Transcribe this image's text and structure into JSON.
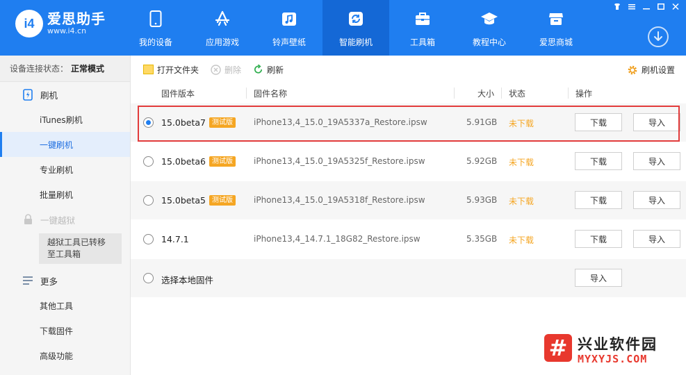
{
  "app": {
    "logo_badge": "i4",
    "name": "爱思助手",
    "url": "www.i4.cn"
  },
  "nav": [
    {
      "label": "我的设备",
      "icon": "phone-icon"
    },
    {
      "label": "应用游戏",
      "icon": "app-store-icon"
    },
    {
      "label": "铃声壁纸",
      "icon": "music-icon"
    },
    {
      "label": "智能刷机",
      "icon": "refresh-icon",
      "active": true
    },
    {
      "label": "工具箱",
      "icon": "toolbox-icon"
    },
    {
      "label": "教程中心",
      "icon": "graduation-cap-icon"
    },
    {
      "label": "爱思商城",
      "icon": "store-icon"
    }
  ],
  "sidebar": {
    "status_label": "设备连接状态：",
    "status_value": "正常模式",
    "flash_group": "刷机",
    "flash_items": [
      "iTunes刷机",
      "一键刷机",
      "专业刷机",
      "批量刷机"
    ],
    "jailbreak_group": "一键越狱",
    "jailbreak_note": "越狱工具已转移至工具箱",
    "more_group": "更多",
    "more_items": [
      "其他工具",
      "下载固件",
      "高级功能"
    ]
  },
  "toolbar": {
    "open_folder": "打开文件夹",
    "delete": "删除",
    "refresh": "刷新",
    "settings": "刷机设置"
  },
  "table": {
    "headers": {
      "version": "固件版本",
      "name": "固件名称",
      "size": "大小",
      "status": "状态",
      "action": "操作"
    },
    "rows": [
      {
        "version": "15.0beta7",
        "badge": "测试版",
        "name": "iPhone13,4_15.0_19A5337a_Restore.ipsw",
        "size": "5.91GB",
        "status": "未下载",
        "download": "下载",
        "import": "导入",
        "selected": true
      },
      {
        "version": "15.0beta6",
        "badge": "测试版",
        "name": "iPhone13,4_15.0_19A5325f_Restore.ipsw",
        "size": "5.92GB",
        "status": "未下载",
        "download": "下载",
        "import": "导入"
      },
      {
        "version": "15.0beta5",
        "badge": "测试版",
        "name": "iPhone13,4_15.0_19A5318f_Restore.ipsw",
        "size": "5.93GB",
        "status": "未下载",
        "download": "下载",
        "import": "导入"
      },
      {
        "version": "14.7.1",
        "name": "iPhone13,4_14.7.1_18G82_Restore.ipsw",
        "size": "5.35GB",
        "status": "未下载",
        "download": "下载",
        "import": "导入"
      }
    ],
    "local_label": "选择本地固件",
    "local_import": "导入"
  },
  "watermark": {
    "title": "兴业软件园",
    "url": "MYXYJS.COM"
  },
  "colors": {
    "header_blue": "#1f7ef0",
    "active_nav": "#1468d6",
    "status_orange": "#f5a623",
    "highlight_red": "#e23b3b"
  }
}
